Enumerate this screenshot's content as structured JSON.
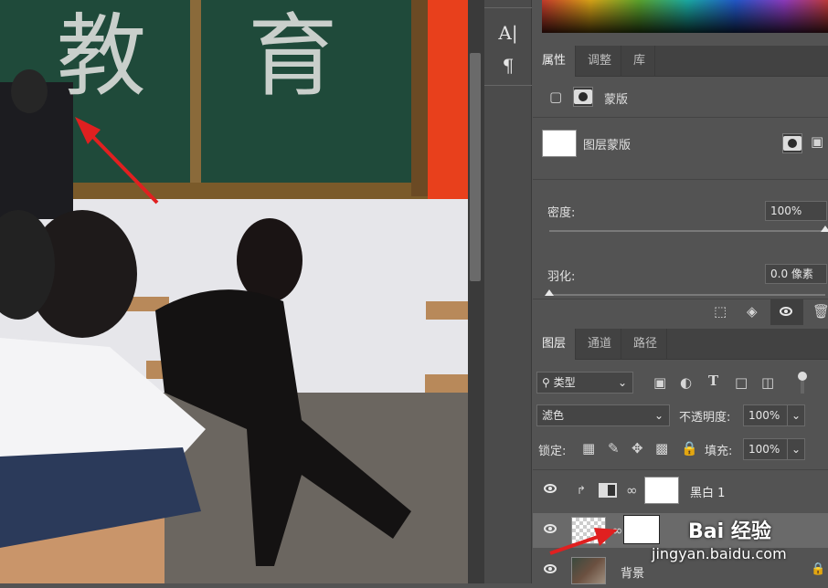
{
  "canvas": {
    "chalkboard_text": "教 育",
    "annotation_arrow_color": "#e02020"
  },
  "tools": [
    {
      "icon": "character-panel-icon",
      "glyph": "A|"
    },
    {
      "icon": "paragraph-panel-icon",
      "glyph": "¶"
    }
  ],
  "properties_panel": {
    "tabs": [
      "属性",
      "调整",
      "库"
    ],
    "active_tab": "属性",
    "section_title": "蒙版",
    "mask_type_label": "图层蒙版",
    "density_label": "密度:",
    "density_value": "100%",
    "density_level": 1.0,
    "feather_label": "羽化:",
    "feather_value": "0.0 像素",
    "feather_level": 0.0
  },
  "layers_panel": {
    "tabs": [
      "图层",
      "通道",
      "路径"
    ],
    "active_tab": "图层",
    "filter_kind": "类型",
    "blend_mode": "滤色",
    "opacity_label": "不透明度:",
    "opacity_value": "100%",
    "lock_label": "锁定:",
    "fill_label": "填充:",
    "fill_value": "100%",
    "layers": [
      {
        "name": "黑白 1",
        "type": "adjustment",
        "clipped": true
      },
      {
        "name": "",
        "type": "pixel-with-mask",
        "selected": true
      },
      {
        "name": "背景",
        "type": "background",
        "locked": true
      }
    ]
  },
  "watermark": {
    "brand": "Bai 经验",
    "url": "jingyan.baidu.com"
  },
  "colors": {
    "accent_arrow": "#e02020",
    "panel_bg": "#535353",
    "tab_bg": "#424242"
  }
}
